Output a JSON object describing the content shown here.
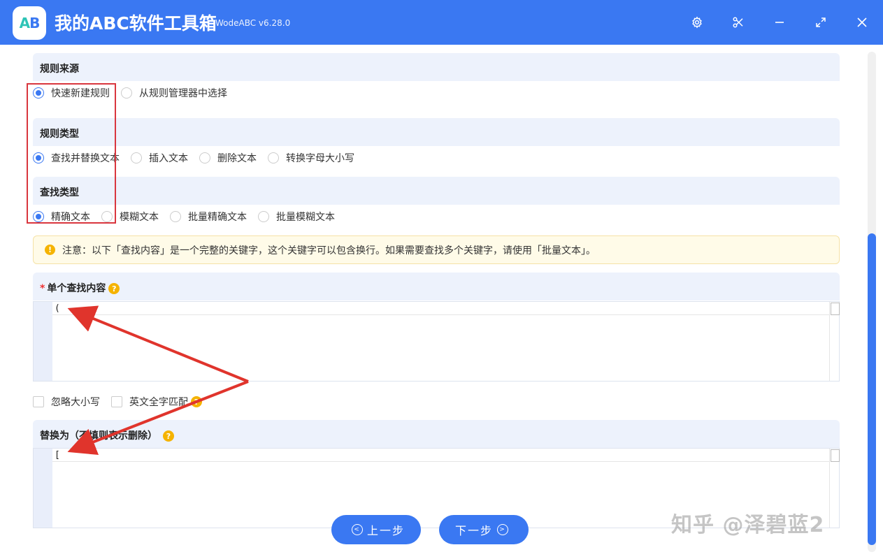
{
  "window": {
    "title": "我的ABC软件工具箱",
    "version": "WodeABC v6.28.0",
    "logo_text_a": "A",
    "logo_text_b": "B",
    "accent": "#3a78f2"
  },
  "sections": {
    "rule_source": {
      "title": "规则来源",
      "options": [
        "快速新建规则",
        "从规则管理器中选择"
      ],
      "selected": "快速新建规则"
    },
    "rule_type": {
      "title": "规则类型",
      "options": [
        "查找并替换文本",
        "插入文本",
        "删除文本",
        "转换字母大小写"
      ],
      "selected": "查找并替换文本"
    },
    "find_type": {
      "title": "查找类型",
      "options": [
        "精确文本",
        "模糊文本",
        "批量精确文本",
        "批量模糊文本"
      ],
      "selected": "精确文本"
    }
  },
  "notice": {
    "icon": "!",
    "text": "注意：以下「查找内容」是一个完整的关键字，这个关键字可以包含换行。如果需要查找多个关键字，请使用「批量文本」。"
  },
  "find_content": {
    "required_mark": "*",
    "title": "单个查找内容",
    "help": "?",
    "value": "("
  },
  "options": {
    "ignore_case": "忽略大小写",
    "whole_word": "英文全字匹配",
    "help": "?"
  },
  "replace": {
    "title": "替换为（不填则表示删除）",
    "help": "?",
    "value": "["
  },
  "buttons": {
    "prev": "上一步",
    "next": "下一步",
    "prev_glyph": "<",
    "next_glyph": ">"
  },
  "watermark": "知乎 @泽碧蓝2"
}
